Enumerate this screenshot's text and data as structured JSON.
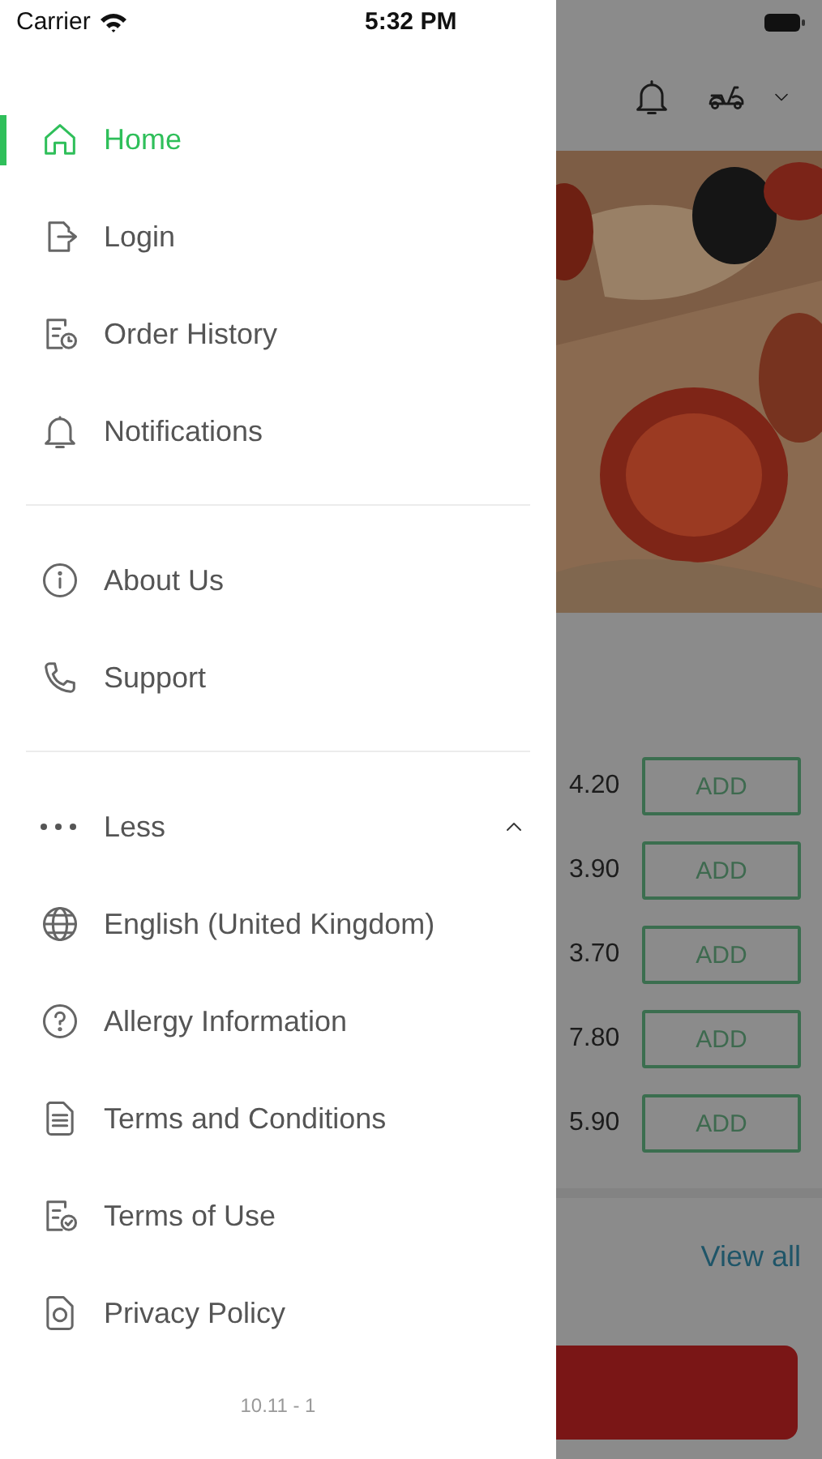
{
  "status_bar": {
    "carrier": "Carrier",
    "time": "5:32 PM"
  },
  "menu": {
    "sections": [
      {
        "items": [
          {
            "label": "Home",
            "selected": true
          },
          {
            "label": "Login",
            "selected": false
          },
          {
            "label": "Order History",
            "selected": false
          },
          {
            "label": "Notifications",
            "selected": false
          }
        ]
      },
      {
        "items": [
          {
            "label": "About Us",
            "selected": false
          },
          {
            "label": "Support",
            "selected": false
          }
        ]
      },
      {
        "toggle": {
          "label": "Less",
          "expanded": true
        },
        "items": [
          {
            "label": "English (United Kingdom)",
            "selected": false
          },
          {
            "label": "Allergy Information",
            "selected": false
          },
          {
            "label": "Terms and Conditions",
            "selected": false
          },
          {
            "label": "Terms of Use",
            "selected": false
          },
          {
            "label": "Privacy Policy",
            "selected": false
          }
        ]
      }
    ],
    "version": "10.11 - 1"
  },
  "background": {
    "products": [
      {
        "price": "4.20",
        "button": "ADD"
      },
      {
        "price": "3.90",
        "button": "ADD"
      },
      {
        "price": "3.70",
        "button": "ADD"
      },
      {
        "price": "7.80",
        "button": "ADD"
      },
      {
        "price": "5.90",
        "button": "ADD"
      }
    ],
    "view_all": "View all"
  }
}
